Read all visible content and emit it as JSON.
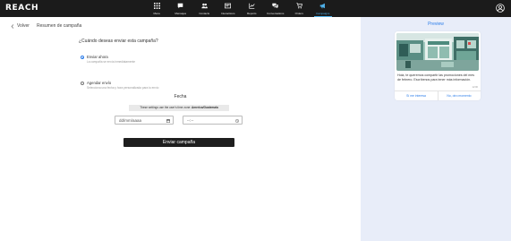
{
  "topbar": {
    "logo": "REACH",
    "nav": [
      {
        "label": "Menu",
        "icon": "grid-icon"
      },
      {
        "label": "Mensajes",
        "icon": "chat-icon"
      },
      {
        "label": "Contacts",
        "icon": "people-icon"
      },
      {
        "label": "Interactions",
        "icon": "interactions-icon"
      },
      {
        "label": "Reports",
        "icon": "chart-icon"
      },
      {
        "label": "Conversations",
        "icon": "conversations-icon"
      },
      {
        "label": "Orders",
        "icon": "cart-icon"
      },
      {
        "label": "Campaigns",
        "icon": "megaphone-icon"
      }
    ],
    "active_index": 7
  },
  "header": {
    "back_label": "Volver",
    "breadcrumb": "Resumen de campaña"
  },
  "form": {
    "question": "¿Cuándo deseas enviar esta campaña?",
    "options": [
      {
        "title": "Enviar ahora",
        "description": "La campaña se envía inmediatamente",
        "selected": true
      },
      {
        "title": "Agendar envío",
        "description": "Selecciona una fecha y hora personalizada para tu envío",
        "selected": false
      }
    ],
    "date_label": "Fecha",
    "timezone_note": "These settings use the user's time zone:",
    "timezone_value": "America/Guatemala",
    "date_placeholder": "dd/mm/aaaa",
    "time_placeholder": "--:--",
    "send_button": "Enviar campaña"
  },
  "preview": {
    "title": "Preview",
    "message": "Hola, te queremos compartir las promociones del mes de febrero. Escríbenos para tener más información.",
    "time": "12:00",
    "buttons": [
      "Sí me interesa",
      "No, otro momento"
    ]
  },
  "colors": {
    "topbar_bg": "#1b1b1b",
    "accent": "#2b7de9",
    "active_nav": "#4fb0e8",
    "preview_bg": "#e8edf9",
    "send_button_bg": "#1e1e1e"
  }
}
